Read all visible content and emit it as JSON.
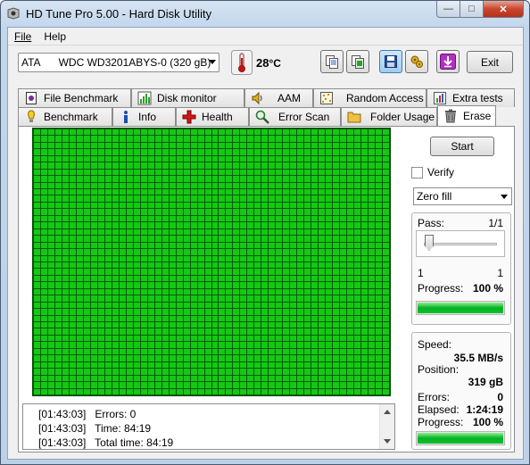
{
  "window": {
    "title": "HD Tune Pro 5.00 - Hard Disk Utility",
    "controls": {
      "minimize": "—",
      "maximize": "□",
      "close": "✕"
    }
  },
  "menu": [
    {
      "label": "File"
    },
    {
      "label": "Help"
    }
  ],
  "toolbar": {
    "drive_type": "ATA",
    "drive_name": "WDC WD3201ABYS-0 (320 gB)",
    "temperature": "28",
    "temperature_unit": "°C",
    "exit_label": "Exit",
    "icons": [
      "copy-info-icon",
      "copy-screenshot-icon",
      "save-icon",
      "options-icon",
      "download-icon"
    ]
  },
  "tabs": {
    "row1": [
      {
        "label": "File Benchmark",
        "icon": "file-benchmark-icon"
      },
      {
        "label": "Disk monitor",
        "icon": "disk-monitor-icon"
      },
      {
        "label": "AAM",
        "icon": "speaker-icon"
      },
      {
        "label": "Random Access",
        "icon": "random-access-icon"
      },
      {
        "label": "Extra tests",
        "icon": "extra-tests-icon"
      }
    ],
    "row2": [
      {
        "label": "Benchmark",
        "icon": "benchmark-icon"
      },
      {
        "label": "Info",
        "icon": "info-icon"
      },
      {
        "label": "Health",
        "icon": "health-cross-icon"
      },
      {
        "label": "Error Scan",
        "icon": "magnifier-icon"
      },
      {
        "label": "Folder Usage",
        "icon": "folder-icon"
      },
      {
        "label": "Erase",
        "icon": "trash-icon",
        "active": true
      }
    ]
  },
  "erase": {
    "start_label": "Start",
    "verify_label": "Verify",
    "verify_checked": false,
    "fill_mode": "Zero fill",
    "grid_color": "#14c814",
    "pass": {
      "label": "Pass:",
      "value": "1/1",
      "slider_min": "1",
      "slider_max": "1",
      "progress_label": "Progress:",
      "progress_value": "100 %",
      "progress_fraction": 1.0
    },
    "stats": {
      "speed_label": "Speed:",
      "speed_value": "35.5 MB/s",
      "position_label": "Position:",
      "position_value": "319 gB",
      "errors_label": "Errors:",
      "errors_value": "0",
      "elapsed_label": "Elapsed:",
      "elapsed_value": "1:24:19",
      "progress_label": "Progress:",
      "progress_value": "100 %",
      "progress_fraction": 1.0
    }
  },
  "log": [
    {
      "time": "[01:43:03]",
      "text": "Errors: 0"
    },
    {
      "time": "[01:43:03]",
      "text": "Time: 84:19"
    },
    {
      "time": "[01:43:03]",
      "text": "Total time: 84:19"
    }
  ]
}
